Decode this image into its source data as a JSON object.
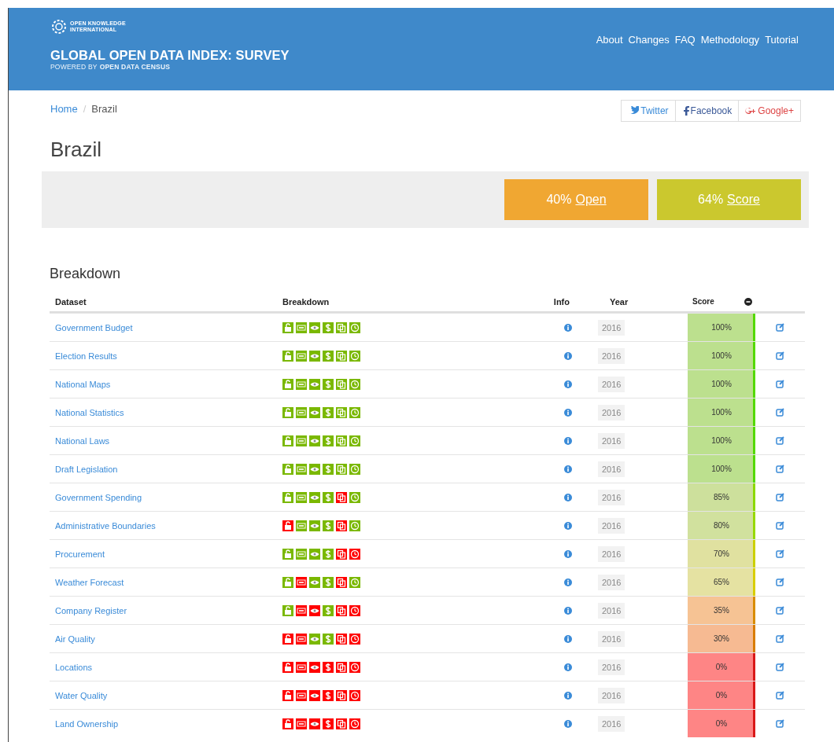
{
  "header": {
    "org_name": "OPEN KNOWLEDGE",
    "org_sub": "INTERNATIONAL",
    "title": "GLOBAL OPEN DATA INDEX: SURVEY",
    "subtitle_prefix": "POWERED BY",
    "subtitle_name": "OPEN DATA CENSUS",
    "nav": [
      "About",
      "Changes",
      "FAQ",
      "Methodology",
      "Tutorial"
    ]
  },
  "breadcrumb": {
    "items": [
      "Home",
      "Brazil"
    ],
    "separator": "/"
  },
  "share": [
    {
      "kind": "twitter",
      "label": "Twitter"
    },
    {
      "kind": "facebook",
      "label": "Facebook"
    },
    {
      "kind": "google",
      "label": "Google+"
    }
  ],
  "place_title": "Brazil",
  "summary": [
    {
      "kind": "open",
      "value": "40%",
      "label": "Open"
    },
    {
      "kind": "score",
      "value": "64%",
      "label": "Score"
    }
  ],
  "breakdown_title": "Breakdown",
  "table": {
    "columns": [
      "Dataset",
      "Breakdown",
      "Info",
      "Year",
      "Score"
    ],
    "rows": [
      {
        "dataset": "Government Budget",
        "checks": [
          true,
          true,
          true,
          true,
          true,
          true
        ],
        "year": "2016",
        "score": "100%",
        "color": "#bce08e"
      },
      {
        "dataset": "Election Results",
        "checks": [
          true,
          true,
          true,
          true,
          true,
          true
        ],
        "year": "2016",
        "score": "100%",
        "color": "#bce08e"
      },
      {
        "dataset": "National Maps",
        "checks": [
          true,
          true,
          true,
          true,
          true,
          true
        ],
        "year": "2016",
        "score": "100%",
        "color": "#bce08e"
      },
      {
        "dataset": "National Statistics",
        "checks": [
          true,
          true,
          true,
          true,
          true,
          true
        ],
        "year": "2016",
        "score": "100%",
        "color": "#bce08e"
      },
      {
        "dataset": "National Laws",
        "checks": [
          true,
          true,
          true,
          true,
          true,
          true
        ],
        "year": "2016",
        "score": "100%",
        "color": "#bce08e"
      },
      {
        "dataset": "Draft Legislation",
        "checks": [
          true,
          true,
          true,
          true,
          true,
          true
        ],
        "year": "2016",
        "score": "100%",
        "color": "#bce08e"
      },
      {
        "dataset": "Government Spending",
        "checks": [
          true,
          true,
          true,
          true,
          false,
          true
        ],
        "year": "2016",
        "score": "85%",
        "color": "#cde09c"
      },
      {
        "dataset": "Administrative Boundaries",
        "checks": [
          false,
          true,
          true,
          true,
          false,
          true
        ],
        "year": "2016",
        "score": "80%",
        "color": "#d1e19e"
      },
      {
        "dataset": "Procurement",
        "checks": [
          true,
          true,
          true,
          true,
          false,
          false
        ],
        "year": "2016",
        "score": "70%",
        "color": "#e0e1a0"
      },
      {
        "dataset": "Weather Forecast",
        "checks": [
          true,
          false,
          true,
          true,
          false,
          true
        ],
        "year": "2016",
        "score": "65%",
        "color": "#e5e2a2"
      },
      {
        "dataset": "Company Register",
        "checks": [
          true,
          false,
          false,
          true,
          false,
          false
        ],
        "year": "2016",
        "score": "35%",
        "color": "#f6c394"
      },
      {
        "dataset": "Air Quality",
        "checks": [
          false,
          false,
          true,
          true,
          false,
          false
        ],
        "year": "2016",
        "score": "30%",
        "color": "#f6ba92"
      },
      {
        "dataset": "Locations",
        "checks": [
          false,
          false,
          false,
          false,
          false,
          false
        ],
        "year": "2016",
        "score": "0%",
        "color": "#fe8585"
      },
      {
        "dataset": "Water Quality",
        "checks": [
          false,
          false,
          false,
          false,
          false,
          false
        ],
        "year": "2016",
        "score": "0%",
        "color": "#fe8585"
      },
      {
        "dataset": "Land Ownership",
        "checks": [
          false,
          false,
          false,
          false,
          false,
          false
        ],
        "year": "2016",
        "score": "0%",
        "color": "#fe8585"
      }
    ]
  }
}
